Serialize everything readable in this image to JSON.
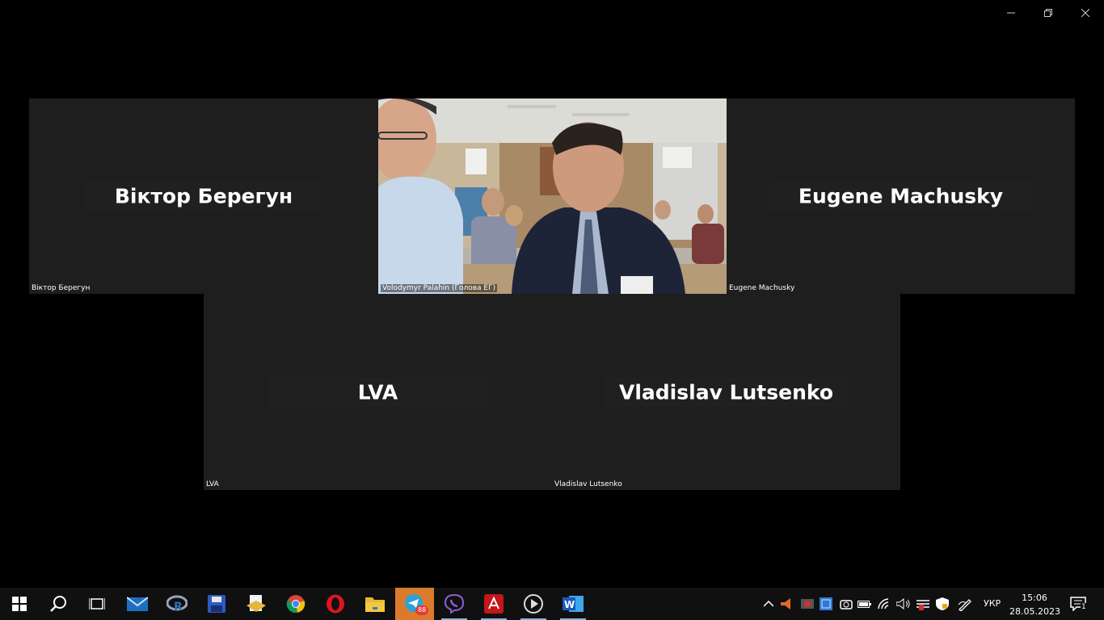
{
  "participants": {
    "top_left": {
      "display_name": "Віктор Берегун",
      "label": "Віктор Берегун"
    },
    "top_center": {
      "label": "Volodymyr Palahin (Голова ЕГ)"
    },
    "top_right": {
      "display_name": "Eugene Machusky",
      "label": "Eugene Machusky"
    },
    "bottom_left": {
      "display_name": "LVA",
      "label": "LVA"
    },
    "bottom_right": {
      "display_name": "Vladislav Lutsenko",
      "label": "Vladislav Lutsenko"
    }
  },
  "taskbar": {
    "apps": [
      {
        "name": "start-icon"
      },
      {
        "name": "search-icon"
      },
      {
        "name": "task-view-icon"
      },
      {
        "name": "mail-icon"
      },
      {
        "name": "r-studio-icon"
      },
      {
        "name": "save-disk-icon"
      },
      {
        "name": "document-app-icon"
      },
      {
        "name": "chrome-icon"
      },
      {
        "name": "opera-icon"
      },
      {
        "name": "file-explorer-icon"
      },
      {
        "name": "telegram-icon",
        "badge": "88",
        "active": true
      },
      {
        "name": "viber-icon"
      },
      {
        "name": "acrobat-icon"
      },
      {
        "name": "media-player-icon"
      },
      {
        "name": "word-icon"
      }
    ],
    "language": "УКР",
    "time": "15:06",
    "date": "28.05.2023",
    "notification_count": "1"
  },
  "colors": {
    "tile_bg": "#1e1e1e",
    "taskbar_bg": "#101010",
    "active_app": "#d97a2c"
  }
}
